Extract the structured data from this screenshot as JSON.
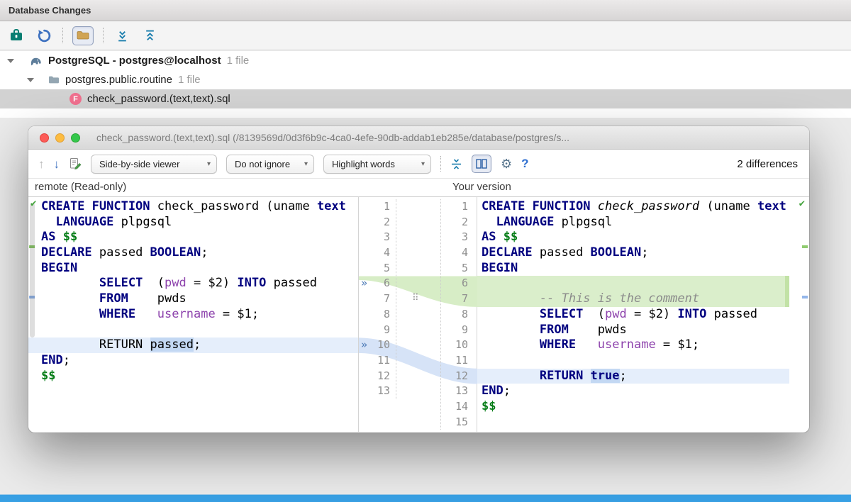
{
  "window": {
    "title": "Database Changes"
  },
  "tree": {
    "items": [
      {
        "label": "PostgreSQL - postgres@localhost",
        "meta": "1 file"
      },
      {
        "label": "postgres.public.routine",
        "meta": "1 file"
      },
      {
        "label": "check_password.(text,text).sql"
      }
    ]
  },
  "dialog": {
    "title": "check_password.(text,text).sql (/8139569d/0d3f6b9c-4ca0-4efe-90db-addab1eb285e/database/postgres/s...",
    "toolbar": {
      "viewer": "Side-by-side viewer",
      "ignore": "Do not ignore",
      "highlight": "Highlight words",
      "differences": "2 differences"
    },
    "headers": {
      "left": "remote (Read-only)",
      "right": "Your version"
    }
  },
  "icons": {
    "chevron_down": "▾",
    "arrow_up": "↑",
    "arrow_down": "↓",
    "gear": "⚙",
    "help": "?",
    "check": "✔",
    "apply": "»",
    "drag": "⠿"
  },
  "colors": {
    "keyword": "#00007f",
    "insert_line_bg": "#daeecb",
    "change_line_bg": "#e5eefb",
    "change_word_bg": "#c3d8f3",
    "bottom_strip": "#38a0e4"
  },
  "diff": {
    "left": {
      "count": 13,
      "markers": [
        6,
        10
      ],
      "lines": [
        {
          "segs": [
            {
              "t": "CREATE FUNCTION",
              "s": "kw"
            },
            {
              "t": " check_password (uname ",
              "s": "p"
            },
            {
              "t": "text",
              "s": "kw"
            }
          ]
        },
        {
          "segs": [
            {
              "t": "  ",
              "s": "p"
            },
            {
              "t": "LANGUAGE",
              "s": "kw"
            },
            {
              "t": " plpgsql",
              "s": "p"
            }
          ]
        },
        {
          "segs": [
            {
              "t": "AS",
              "s": "kw"
            },
            {
              "t": " ",
              "s": "p"
            },
            {
              "t": "$$",
              "s": "dol"
            }
          ]
        },
        {
          "segs": [
            {
              "t": "DECLARE",
              "s": "kw"
            },
            {
              "t": " passed ",
              "s": "p"
            },
            {
              "t": "BOOLEAN",
              "s": "kw"
            },
            {
              "t": ";",
              "s": "p"
            }
          ]
        },
        {
          "segs": [
            {
              "t": "BEGIN",
              "s": "kw"
            }
          ]
        },
        {
          "segs": [
            {
              "t": "        ",
              "s": "p"
            },
            {
              "t": "SELECT",
              "s": "kw"
            },
            {
              "t": "  (",
              "s": "p"
            },
            {
              "t": "pwd",
              "s": "var"
            },
            {
              "t": " = $2) ",
              "s": "p"
            },
            {
              "t": "INTO",
              "s": "kw"
            },
            {
              "t": " passed",
              "s": "p"
            }
          ]
        },
        {
          "segs": [
            {
              "t": "        ",
              "s": "p"
            },
            {
              "t": "FROM",
              "s": "kw"
            },
            {
              "t": "    pwds",
              "s": "p"
            }
          ]
        },
        {
          "segs": [
            {
              "t": "        ",
              "s": "p"
            },
            {
              "t": "WHERE",
              "s": "kw"
            },
            {
              "t": "   ",
              "s": "p"
            },
            {
              "t": "username",
              "s": "var"
            },
            {
              "t": " = $1;",
              "s": "p"
            }
          ]
        },
        {
          "segs": []
        },
        {
          "bg": "blue",
          "segs": [
            {
              "t": "        RETURN ",
              "s": "p"
            },
            {
              "t": "passed",
              "s": "p wb"
            },
            {
              "t": ";",
              "s": "p"
            }
          ]
        },
        {
          "segs": [
            {
              "t": "END",
              "s": "kw"
            },
            {
              "t": ";",
              "s": "p"
            }
          ]
        },
        {
          "segs": [
            {
              "t": "$$",
              "s": "dol"
            }
          ]
        },
        {
          "segs": []
        }
      ]
    },
    "right": {
      "count": 15,
      "lines": [
        {
          "segs": [
            {
              "t": "CREATE FUNCTION",
              "s": "kw"
            },
            {
              "t": " ",
              "s": "p"
            },
            {
              "t": "check_password",
              "s": "it"
            },
            {
              "t": " (uname ",
              "s": "p"
            },
            {
              "t": "text",
              "s": "kw"
            }
          ]
        },
        {
          "segs": [
            {
              "t": "  ",
              "s": "p"
            },
            {
              "t": "LANGUAGE",
              "s": "kw"
            },
            {
              "t": " plpgsql",
              "s": "p"
            }
          ]
        },
        {
          "segs": [
            {
              "t": "AS",
              "s": "kw"
            },
            {
              "t": " ",
              "s": "p"
            },
            {
              "t": "$$",
              "s": "dol"
            }
          ]
        },
        {
          "segs": [
            {
              "t": "DECLARE",
              "s": "kw"
            },
            {
              "t": " passed ",
              "s": "p"
            },
            {
              "t": "BOOLEAN",
              "s": "kw"
            },
            {
              "t": ";",
              "s": "p"
            }
          ]
        },
        {
          "segs": [
            {
              "t": "BEGIN",
              "s": "kw"
            }
          ]
        },
        {
          "bg": "green",
          "segs": []
        },
        {
          "bg": "green",
          "segs": [
            {
              "t": "        ",
              "s": "p"
            },
            {
              "t": "-- This is the comment",
              "s": "com"
            }
          ]
        },
        {
          "segs": [
            {
              "t": "        ",
              "s": "p"
            },
            {
              "t": "SELECT",
              "s": "kw"
            },
            {
              "t": "  (",
              "s": "p"
            },
            {
              "t": "pwd",
              "s": "var"
            },
            {
              "t": " = $2) ",
              "s": "p"
            },
            {
              "t": "INTO",
              "s": "kw"
            },
            {
              "t": " passed",
              "s": "p"
            }
          ]
        },
        {
          "segs": [
            {
              "t": "        ",
              "s": "p"
            },
            {
              "t": "FROM",
              "s": "kw"
            },
            {
              "t": "    pwds",
              "s": "p"
            }
          ]
        },
        {
          "segs": [
            {
              "t": "        ",
              "s": "p"
            },
            {
              "t": "WHERE",
              "s": "kw"
            },
            {
              "t": "   ",
              "s": "p"
            },
            {
              "t": "username",
              "s": "var"
            },
            {
              "t": " = $1;",
              "s": "p"
            }
          ]
        },
        {
          "segs": []
        },
        {
          "bg": "blue",
          "segs": [
            {
              "t": "        ",
              "s": "p"
            },
            {
              "t": "RETURN ",
              "s": "kw"
            },
            {
              "t": "true",
              "s": "kw wb"
            },
            {
              "t": ";",
              "s": "p"
            }
          ]
        },
        {
          "segs": [
            {
              "t": "END",
              "s": "kw"
            },
            {
              "t": ";",
              "s": "p"
            }
          ]
        },
        {
          "segs": [
            {
              "t": "$$",
              "s": "dol"
            }
          ]
        },
        {
          "segs": []
        }
      ]
    }
  }
}
